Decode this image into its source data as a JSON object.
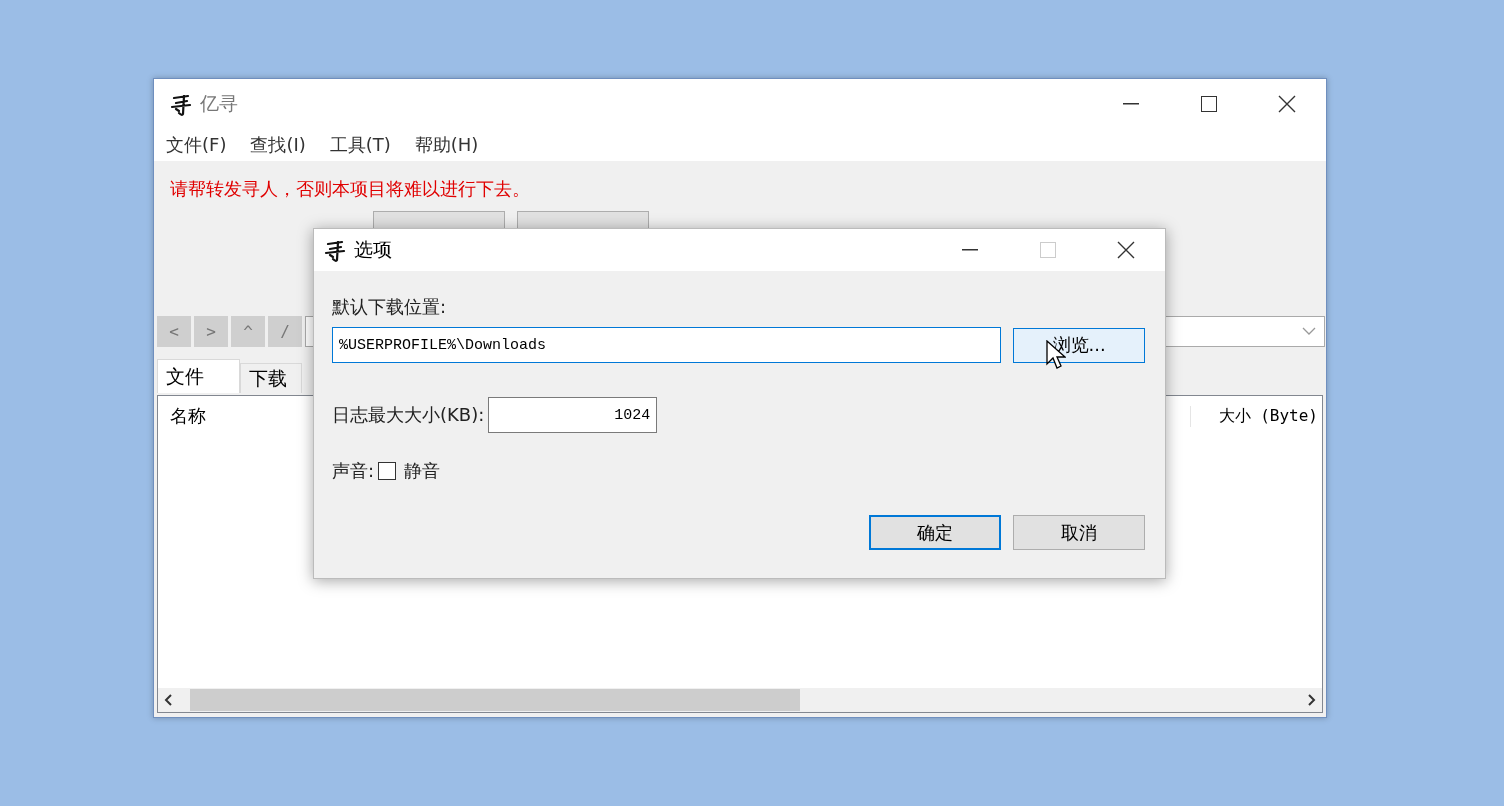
{
  "window": {
    "title": "亿寻"
  },
  "menu": [
    "文件(F)",
    "查找(I)",
    "工具(T)",
    "帮助(H)"
  ],
  "notice": "请帮转发寻人，否则本项目将难以进行下去。",
  "nav_buttons": [
    "<",
    ">",
    "^",
    "/"
  ],
  "tabs": [
    {
      "label": "文件",
      "selected": true
    },
    {
      "label": "下载",
      "selected": false
    }
  ],
  "table": {
    "columns": [
      "名称",
      "大小 (Byte)"
    ]
  },
  "dialog": {
    "title": "选项",
    "download_label": "默认下载位置:",
    "download_path": "%USERPROFILE%\\Downloads",
    "browse_button": {
      "label": "浏览...",
      "hovered": true
    },
    "log_label": "日志最大大小(KB):",
    "log_size": "1024",
    "sound_label": "声音:",
    "mute": {
      "label": "静音",
      "checked": false
    },
    "buttons": [
      {
        "label": "确定",
        "default": true
      },
      {
        "label": "取消",
        "default": false
      }
    ]
  }
}
